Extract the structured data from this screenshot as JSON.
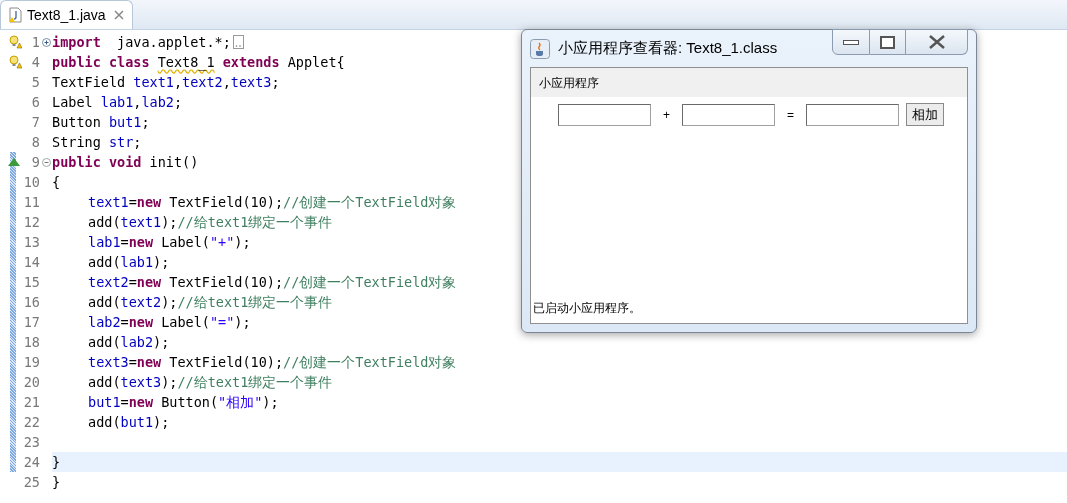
{
  "editor": {
    "tab": {
      "title": "Text8_1.java",
      "selected": true
    },
    "lines": [
      {
        "number": "1",
        "fold_marker": {
          "expanded": false
        },
        "warning": true,
        "override": false,
        "changed": false,
        "current": false,
        "indent": false,
        "folded_code": true,
        "tokens": [
          {
            "kind": "keyword",
            "text": "import"
          },
          {
            "kind": "plain",
            "text": "  java.applet.*;"
          }
        ]
      },
      {
        "number": "4",
        "warning": true,
        "override": false,
        "changed": false,
        "current": false,
        "indent": false,
        "tokens": [
          {
            "kind": "keyword",
            "text": "public class "
          },
          {
            "kind": "squiggle",
            "text": "Text8_1"
          },
          {
            "kind": "keyword",
            "text": " extends"
          },
          {
            "kind": "plain",
            "text": " Applet{"
          }
        ]
      },
      {
        "number": "5",
        "warning": false,
        "override": false,
        "changed": false,
        "current": false,
        "indent": false,
        "tokens": [
          {
            "kind": "plain",
            "text": "TextField "
          },
          {
            "kind": "field",
            "text": "text1"
          },
          {
            "kind": "plain",
            "text": ","
          },
          {
            "kind": "field",
            "text": "text2"
          },
          {
            "kind": "plain",
            "text": ","
          },
          {
            "kind": "field",
            "text": "text3"
          },
          {
            "kind": "plain",
            "text": ";"
          }
        ]
      },
      {
        "number": "6",
        "warning": false,
        "override": false,
        "changed": false,
        "current": false,
        "indent": false,
        "tokens": [
          {
            "kind": "plain",
            "text": "Label "
          },
          {
            "kind": "field",
            "text": "lab1"
          },
          {
            "kind": "plain",
            "text": ","
          },
          {
            "kind": "field",
            "text": "lab2"
          },
          {
            "kind": "plain",
            "text": ";"
          }
        ]
      },
      {
        "number": "7",
        "warning": false,
        "override": false,
        "changed": false,
        "current": false,
        "indent": false,
        "tokens": [
          {
            "kind": "plain",
            "text": "Button "
          },
          {
            "kind": "field",
            "text": "but1"
          },
          {
            "kind": "plain",
            "text": ";"
          }
        ]
      },
      {
        "number": "8",
        "warning": false,
        "override": false,
        "changed": false,
        "current": false,
        "indent": false,
        "tokens": [
          {
            "kind": "plain",
            "text": "String "
          },
          {
            "kind": "field",
            "text": "str"
          },
          {
            "kind": "plain",
            "text": ";"
          }
        ]
      },
      {
        "number": "9",
        "fold_marker": {
          "expanded": true
        },
        "warning": false,
        "override": true,
        "changed": true,
        "current": false,
        "indent": false,
        "tokens": [
          {
            "kind": "keyword",
            "text": "public void"
          },
          {
            "kind": "plain",
            "text": " init()"
          }
        ]
      },
      {
        "number": "10",
        "warning": false,
        "override": false,
        "changed": true,
        "current": false,
        "indent": false,
        "tokens": [
          {
            "kind": "plain",
            "text": "{"
          }
        ]
      },
      {
        "number": "11",
        "warning": false,
        "override": false,
        "changed": true,
        "current": false,
        "indent": true,
        "tokens": [
          {
            "kind": "field",
            "text": "text1"
          },
          {
            "kind": "plain",
            "text": "="
          },
          {
            "kind": "keyword",
            "text": "new"
          },
          {
            "kind": "plain",
            "text": " TextField(10);"
          },
          {
            "kind": "comment",
            "text": "//创建一个TextField对象"
          }
        ]
      },
      {
        "number": "12",
        "warning": false,
        "override": false,
        "changed": true,
        "current": false,
        "indent": true,
        "tokens": [
          {
            "kind": "plain",
            "text": "add("
          },
          {
            "kind": "field",
            "text": "text1"
          },
          {
            "kind": "plain",
            "text": ");"
          },
          {
            "kind": "comment",
            "text": "//给text1绑定一个事件"
          }
        ]
      },
      {
        "number": "13",
        "warning": false,
        "override": false,
        "changed": true,
        "current": false,
        "indent": true,
        "tokens": [
          {
            "kind": "field",
            "text": "lab1"
          },
          {
            "kind": "plain",
            "text": "="
          },
          {
            "kind": "keyword",
            "text": "new"
          },
          {
            "kind": "plain",
            "text": " Label("
          },
          {
            "kind": "string",
            "text": "\"+\""
          },
          {
            "kind": "plain",
            "text": ");"
          }
        ]
      },
      {
        "number": "14",
        "warning": false,
        "override": false,
        "changed": true,
        "current": false,
        "indent": true,
        "tokens": [
          {
            "kind": "plain",
            "text": "add("
          },
          {
            "kind": "field",
            "text": "lab1"
          },
          {
            "kind": "plain",
            "text": ");"
          }
        ]
      },
      {
        "number": "15",
        "warning": false,
        "override": false,
        "changed": true,
        "current": false,
        "indent": true,
        "tokens": [
          {
            "kind": "field",
            "text": "text2"
          },
          {
            "kind": "plain",
            "text": "="
          },
          {
            "kind": "keyword",
            "text": "new"
          },
          {
            "kind": "plain",
            "text": " TextField(10);"
          },
          {
            "kind": "comment",
            "text": "//创建一个TextField对象"
          }
        ]
      },
      {
        "number": "16",
        "warning": false,
        "override": false,
        "changed": true,
        "current": false,
        "indent": true,
        "tokens": [
          {
            "kind": "plain",
            "text": "add("
          },
          {
            "kind": "field",
            "text": "text2"
          },
          {
            "kind": "plain",
            "text": ");"
          },
          {
            "kind": "comment",
            "text": "//给text1绑定一个事件"
          }
        ]
      },
      {
        "number": "17",
        "warning": false,
        "override": false,
        "changed": true,
        "current": false,
        "indent": true,
        "tokens": [
          {
            "kind": "field",
            "text": "lab2"
          },
          {
            "kind": "plain",
            "text": "="
          },
          {
            "kind": "keyword",
            "text": "new"
          },
          {
            "kind": "plain",
            "text": " Label("
          },
          {
            "kind": "string",
            "text": "\"=\""
          },
          {
            "kind": "plain",
            "text": ");"
          }
        ]
      },
      {
        "number": "18",
        "warning": false,
        "override": false,
        "changed": true,
        "current": false,
        "indent": true,
        "tokens": [
          {
            "kind": "plain",
            "text": "add("
          },
          {
            "kind": "field",
            "text": "lab2"
          },
          {
            "kind": "plain",
            "text": ");"
          }
        ]
      },
      {
        "number": "19",
        "warning": false,
        "override": false,
        "changed": true,
        "current": false,
        "indent": true,
        "tokens": [
          {
            "kind": "field",
            "text": "text3"
          },
          {
            "kind": "plain",
            "text": "="
          },
          {
            "kind": "keyword",
            "text": "new"
          },
          {
            "kind": "plain",
            "text": " TextField(10);"
          },
          {
            "kind": "comment",
            "text": "//创建一个TextField对象"
          }
        ]
      },
      {
        "number": "20",
        "warning": false,
        "override": false,
        "changed": true,
        "current": false,
        "indent": true,
        "tokens": [
          {
            "kind": "plain",
            "text": "add("
          },
          {
            "kind": "field",
            "text": "text3"
          },
          {
            "kind": "plain",
            "text": ");"
          },
          {
            "kind": "comment",
            "text": "//给text1绑定一个事件"
          }
        ]
      },
      {
        "number": "21",
        "warning": false,
        "override": false,
        "changed": true,
        "current": false,
        "indent": true,
        "tokens": [
          {
            "kind": "field",
            "text": "but1"
          },
          {
            "kind": "plain",
            "text": "="
          },
          {
            "kind": "keyword",
            "text": "new"
          },
          {
            "kind": "plain",
            "text": " Button("
          },
          {
            "kind": "string",
            "text": "\"相加\""
          },
          {
            "kind": "plain",
            "text": ");"
          }
        ]
      },
      {
        "number": "22",
        "warning": false,
        "override": false,
        "changed": true,
        "current": false,
        "indent": true,
        "tokens": [
          {
            "kind": "plain",
            "text": "add("
          },
          {
            "kind": "field",
            "text": "but1"
          },
          {
            "kind": "plain",
            "text": ");"
          }
        ]
      },
      {
        "number": "23",
        "warning": false,
        "override": false,
        "changed": true,
        "current": false,
        "indent": false
      },
      {
        "number": "24",
        "warning": false,
        "override": false,
        "changed": true,
        "current": true,
        "indent": false,
        "tokens": [
          {
            "kind": "plain",
            "text": "}"
          }
        ]
      },
      {
        "number": "25",
        "warning": false,
        "override": false,
        "changed": false,
        "current": false,
        "indent": false,
        "tokens": [
          {
            "kind": "plain",
            "text": "}"
          }
        ]
      }
    ]
  },
  "applet_window": {
    "title": "小应用程序查看器: Text8_1.class",
    "menu": "小应用程序",
    "controls": [
      {
        "kind": "textfield"
      },
      {
        "kind": "label",
        "text": "+"
      },
      {
        "kind": "textfield"
      },
      {
        "kind": "label",
        "text": "="
      },
      {
        "kind": "textfield"
      },
      {
        "kind": "button",
        "text": "相加"
      }
    ],
    "status": "已启动小应用程序。"
  }
}
